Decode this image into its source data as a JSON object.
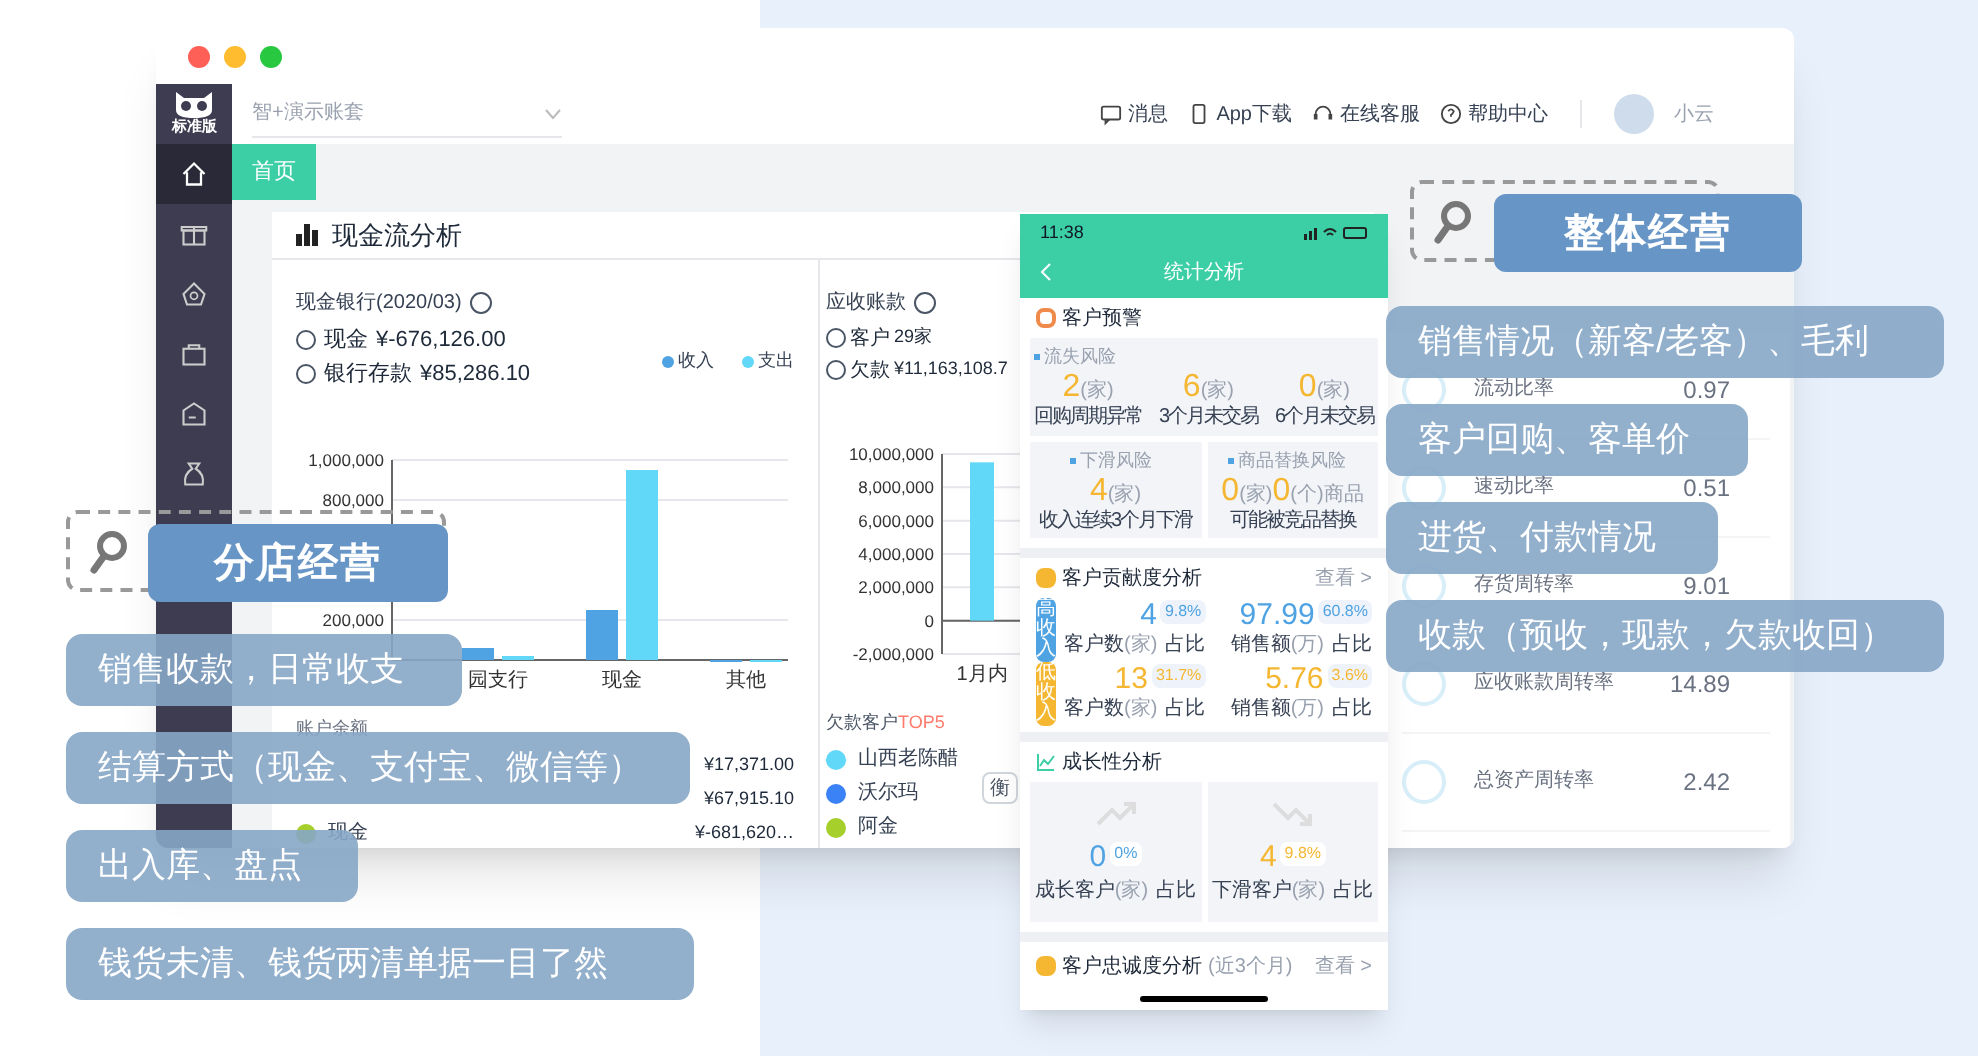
{
  "app": {
    "logo": "标准版",
    "account_selector": "智+演示账套",
    "header_links": [
      "消息",
      "App下载",
      "在线客服",
      "帮助中心"
    ],
    "user_name": "小云",
    "sidebar": [
      {
        "selected": true
      },
      {
        "selected": false
      },
      {
        "selected": false
      },
      {
        "selected": false
      },
      {
        "selected": false
      },
      {
        "selected": false
      }
    ],
    "tabs": [
      {
        "label": "首页",
        "selected": true
      }
    ],
    "cash_flow_card": {
      "title": "现金流分析",
      "cash_bank": {
        "heading": "现金银行(2020/03)",
        "lines": [
          {
            "label": "现金",
            "value": "¥-676,126.00"
          },
          {
            "label": "银行存款",
            "value": "¥85,286.10"
          }
        ],
        "chart_data": {
          "type": "bar",
          "grid": true,
          "categories": [
            "园支行",
            "现金",
            "其他"
          ],
          "series": [
            {
              "name": "收入",
              "color": "#4fa3e3",
              "values": [
                60000,
                250000,
                0
              ]
            },
            {
              "name": "支出",
              "color": "#62d8f8",
              "values": [
                20000,
                950000,
                0
              ]
            }
          ],
          "ylim": [
            0,
            1000000
          ],
          "yticks": [
            {
              "value": 200000,
              "label": "200,000"
            },
            {
              "value": 800000,
              "label": "800,000"
            },
            {
              "value": 1000000,
              "label": "1,000,000"
            }
          ]
        }
      },
      "account_balance": {
        "heading": "账户余额",
        "rows": [
          {
            "amount": "¥17,371.00"
          },
          {
            "amount": "¥67,915.10"
          },
          {
            "name": "现金",
            "amount": "¥-681,620…",
            "color": "#a6cf2b"
          }
        ]
      },
      "receivables": {
        "heading": "应收账款",
        "lines": [
          {
            "label": "客户",
            "value": "29家"
          },
          {
            "label": "欠款",
            "value": "¥11,163,108.7"
          }
        ],
        "chart_data": {
          "type": "bar",
          "grid": true,
          "categories": [
            "1月内"
          ],
          "series": [
            {
              "color": "#62d8f8",
              "values": [
                9500000
              ]
            }
          ],
          "ylim": [
            -2000000,
            10000000
          ],
          "yticks": [
            {
              "value": -2000000,
              "label": "-2,000,000"
            },
            {
              "value": 0,
              "label": "0"
            },
            {
              "value": 2000000,
              "label": "2,000,000"
            },
            {
              "value": 4000000,
              "label": "4,000,000"
            },
            {
              "value": 6000000,
              "label": "6,000,000"
            },
            {
              "value": 8000000,
              "label": "8,000,000"
            },
            {
              "value": 10000000,
              "label": "10,000,000"
            }
          ]
        }
      },
      "top_debtors": {
        "heading": "欠款客户",
        "highlight": "TOP5",
        "rows": [
          {
            "name": "山西老陈醋",
            "color": "#62d8f8"
          },
          {
            "name": "沃尔玛",
            "color": "#3b82f6"
          },
          {
            "name": "阿金",
            "color": "#a6cf2b"
          }
        ]
      },
      "filter_button": "衡"
    },
    "liquidity_card": {
      "rows": [
        {
          "label": "流动比率",
          "value": "0.97"
        },
        {
          "label": "速动比率",
          "value": "0.51"
        },
        {
          "label": "存货周转率",
          "value": "9.01"
        },
        {
          "label": "应收账款周转率",
          "value": "14.89"
        },
        {
          "label": "总资产周转率",
          "value": "2.42"
        }
      ]
    }
  },
  "phone": {
    "time": "11:38",
    "title": "统计分析",
    "warning": {
      "title": "客户预警",
      "churn": {
        "label": "流失风险",
        "stats": [
          {
            "value": "2",
            "unit": "(家)",
            "caption": "回购周期异常"
          },
          {
            "value": "6",
            "unit": "(家)",
            "caption": "3个月未交易"
          },
          {
            "value": "0",
            "unit": "(家)",
            "caption": "6个月未交易"
          }
        ]
      },
      "decline": {
        "label": "下滑风险",
        "value": "4",
        "unit": "(家)",
        "caption": "收入连续3个月下滑"
      },
      "replace": {
        "label": "商品替换风险",
        "value_1": "0",
        "unit_1": "(家)",
        "value_2": "0",
        "unit_2": "(个)商品",
        "caption": "可能被竞品替换"
      }
    },
    "contribution": {
      "title": "客户贡献度分析",
      "link": "查看 >",
      "rows": [
        {
          "tag": "高收入",
          "color": "#4fa3e3",
          "count": "4",
          "count_share": "9.8%",
          "count_caption": "客户数",
          "count_unit": "(家)",
          "count_share_label": "占比",
          "sales": "97.99",
          "sales_share": "60.8%",
          "sales_caption": "销售额",
          "sales_unit": "(万)",
          "sales_share_label": "占比"
        },
        {
          "tag": "低收入",
          "color": "#f5b731",
          "count": "13",
          "count_share": "31.7%",
          "count_caption": "客户数",
          "count_unit": "(家)",
          "count_share_label": "占比",
          "sales": "5.76",
          "sales_share": "3.6%",
          "sales_caption": "销售额",
          "sales_unit": "(万)",
          "sales_share_label": "占比"
        }
      ]
    },
    "growth": {
      "title": "成长性分析",
      "cards": [
        {
          "kind": "up",
          "value": "0",
          "share": "0%",
          "caption": "成长客户",
          "unit": "(家)",
          "share_label": "占比"
        },
        {
          "kind": "down",
          "value": "4",
          "share": "9.8%",
          "caption": "下滑客户",
          "unit": "(家)",
          "share_label": "占比"
        }
      ]
    },
    "loyalty": {
      "title": "客户忠诚度分析",
      "subtitle": "(近3个月)",
      "link": "查看 >"
    }
  },
  "callouts": [
    {
      "title": "分店经营",
      "items": [
        "销售收款，日常收支",
        "结算方式（现金、支付宝、微信等）",
        "出入库、盘点",
        "钱货未清、钱货两清单据一目了然"
      ]
    },
    {
      "title": "整体经营",
      "items": [
        "销售情况（新客/老客）、毛利",
        "客户回购、客单价",
        "进货、付款情况",
        "收款（预收，现款，欠款收回）"
      ]
    }
  ]
}
